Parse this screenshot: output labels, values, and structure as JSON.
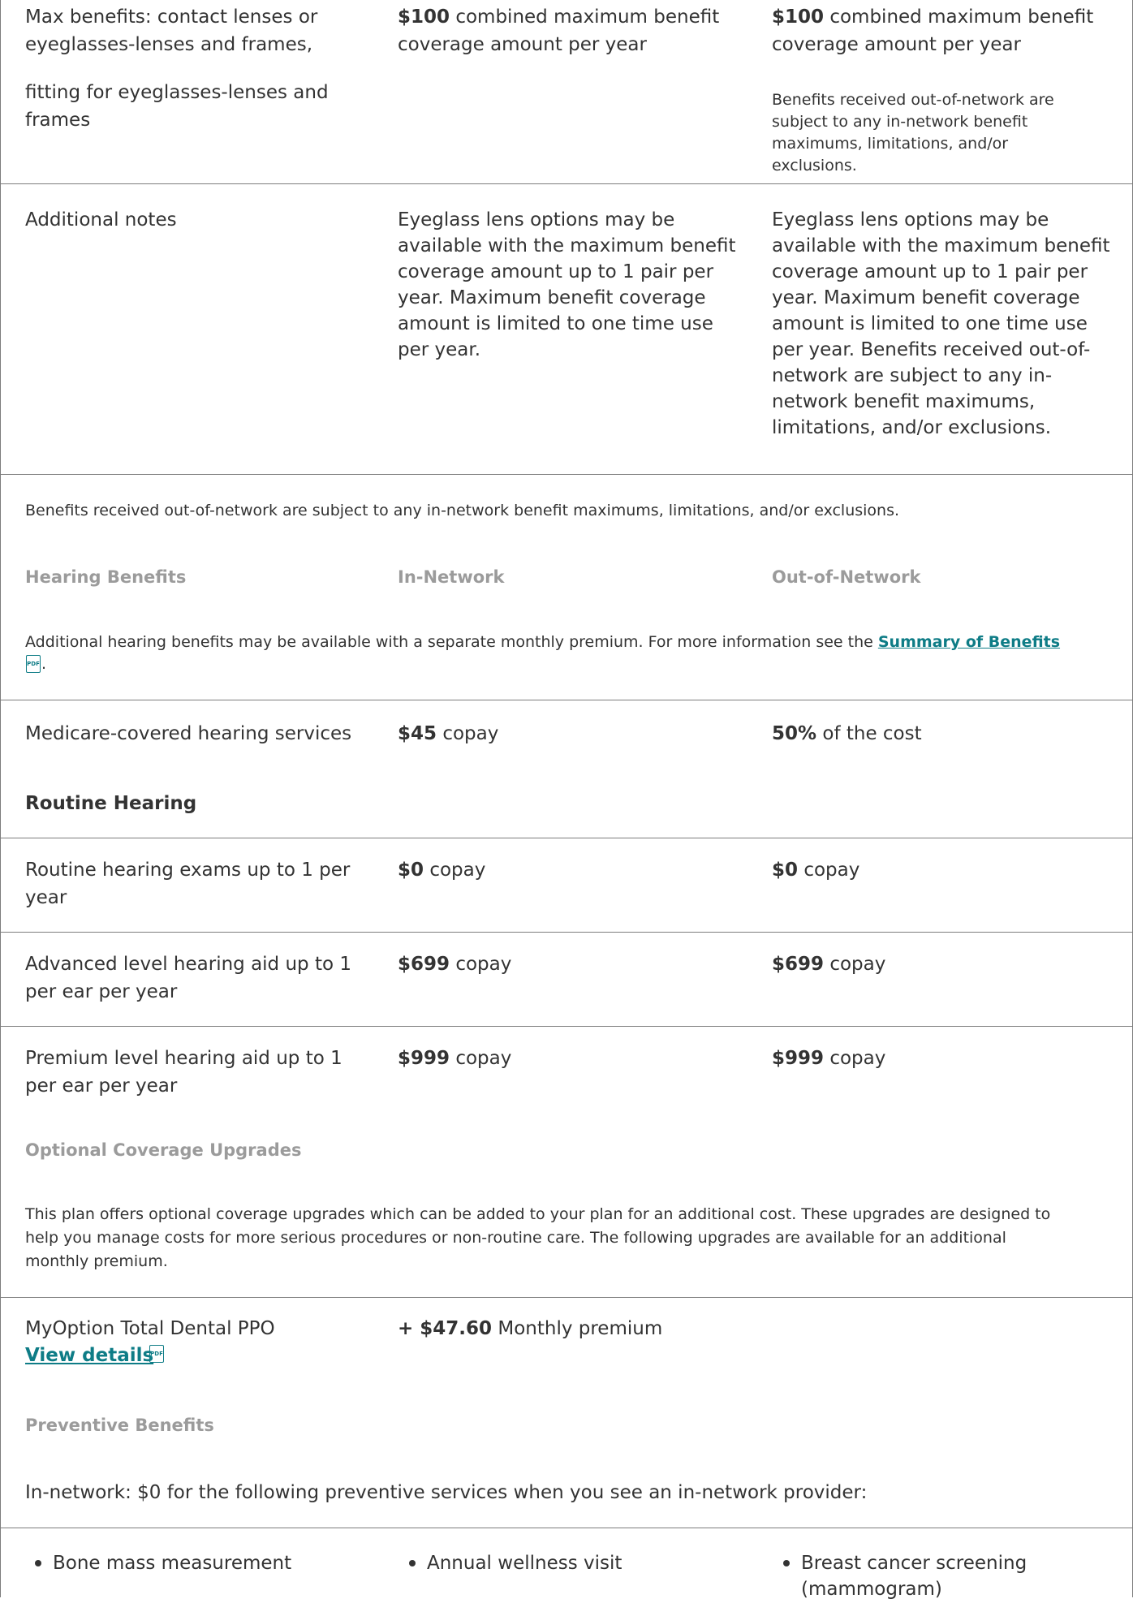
{
  "vision_tail": {
    "max_benefits_label_line1": "Max benefits: contact lenses or",
    "max_benefits_label_line2": "eyeglasses-lenses and frames,",
    "max_benefits_label_line3": "fitting for eyeglasses-lenses and",
    "max_benefits_label_line4": "frames",
    "in_amount": "$100",
    "in_text_line1": " combined maximum benefit",
    "in_text_line2": "coverage amount per year",
    "out_amount": "$100",
    "out_text_line1": " combined maximum benefit",
    "out_text_line2": "coverage amount per year",
    "out_note_line1": "Benefits received out-of-network are",
    "out_note_line2": "subject to any in-network benefit",
    "out_note_line3": "maximums, limitations, and/or",
    "out_note_line4": "exclusions."
  },
  "additional_notes": {
    "label": "Additional notes",
    "in_lines": [
      "Eyeglass lens options may be",
      "available with the maximum benefit",
      "coverage amount up to 1 pair per",
      "year. Maximum benefit coverage",
      "amount is limited to one time use",
      "per year."
    ],
    "out_lines": [
      "Eyeglass lens options may be",
      "available with the maximum benefit",
      "coverage amount up to 1 pair per",
      "year. Maximum benefit coverage",
      "amount is limited to one time use",
      "per year. Benefits received out-of-",
      "network are subject to any in-",
      "network benefit maximums,",
      "limitations, and/or exclusions."
    ]
  },
  "out_network_disclaimer": "Benefits received out-of-network are subject to any in-network benefit maximums, limitations, and/or exclusions.",
  "hearing": {
    "header_col1": "Hearing Benefits",
    "header_col2": "In-Network",
    "header_col3": "Out-of-Network",
    "intro_prefix": "Additional hearing benefits may be available with a separate monthly premium. For more information see the ",
    "intro_link": "Summary of Benefits",
    "intro_suffix": ".",
    "pdf_icon_label": "PDF",
    "medicare_label": "Medicare-covered hearing services",
    "medicare_in_amount": "$45",
    "medicare_in_text": " copay",
    "medicare_out_amount": "50%",
    "medicare_out_text": " of the cost",
    "routine_heading": "Routine Hearing",
    "rows": [
      {
        "label_line1": "Routine hearing exams up to 1 per",
        "label_line2": "year",
        "in_amount": "$0",
        "in_text": " copay",
        "out_amount": "$0",
        "out_text": " copay"
      },
      {
        "label_line1": "Advanced level hearing aid up to 1",
        "label_line2": "per ear per year",
        "in_amount": "$699",
        "in_text": " copay",
        "out_amount": "$699",
        "out_text": " copay"
      },
      {
        "label_line1": "Premium level hearing aid up to 1",
        "label_line2": "per ear per year",
        "in_amount": "$999",
        "in_text": " copay",
        "out_amount": "$999",
        "out_text": " copay"
      }
    ]
  },
  "upgrades": {
    "header": "Optional Coverage Upgrades",
    "intro_line1": "This plan offers optional coverage upgrades which can be added to your plan for an additional cost. These upgrades are designed to",
    "intro_line2": "help you manage costs for more serious procedures or non-routine care. The following upgrades are available for an additional",
    "intro_line3": "monthly premium.",
    "plan_name": "MyOption Total Dental PPO",
    "view_details": "View details",
    "premium_amount": "+ $47.60",
    "premium_text": " Monthly premium"
  },
  "preventive": {
    "header": "Preventive Benefits",
    "intro": "In-network: $0 for the following preventive services when you see an in-network provider:",
    "items": [
      "Bone mass measurement",
      "Annual wellness visit",
      "Breast cancer screening",
      "(mammogram)"
    ]
  }
}
